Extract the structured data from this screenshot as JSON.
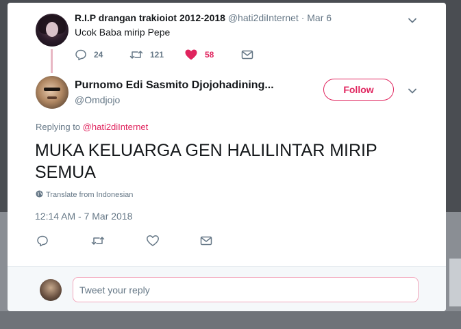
{
  "parent_tweet": {
    "display_name": "R.I.P drangan trakioiot 2012-2018",
    "handle": "@hati2diInternet",
    "separator": "·",
    "date": "Mar 6",
    "text": "Ucok Baba mirip Pepe",
    "actions": {
      "reply_count": "24",
      "retweet_count": "121",
      "like_count": "58"
    }
  },
  "main_tweet": {
    "display_name": "Purnomo Edi Sasmito Djojohadining...",
    "handle": "@Omdjojo",
    "follow_label": "Follow",
    "replying_prefix": "Replying to",
    "replying_mention": "@hati2diInternet",
    "text": "MUKA KELUARGA GEN HALILINTAR MIRIP SEMUA",
    "translate_label": "Translate from Indonesian",
    "timestamp": "12:14 AM - 7 Mar 2018"
  },
  "reply_box": {
    "placeholder": "Tweet your reply"
  },
  "icons": {
    "reply": "reply-icon",
    "retweet": "retweet-icon",
    "like": "heart-icon",
    "dm": "envelope-icon",
    "caret": "chevron-down-icon",
    "translate": "globe-icon"
  },
  "colors": {
    "accent": "#e0245e",
    "text_primary": "#14171a",
    "text_secondary": "#657786"
  }
}
